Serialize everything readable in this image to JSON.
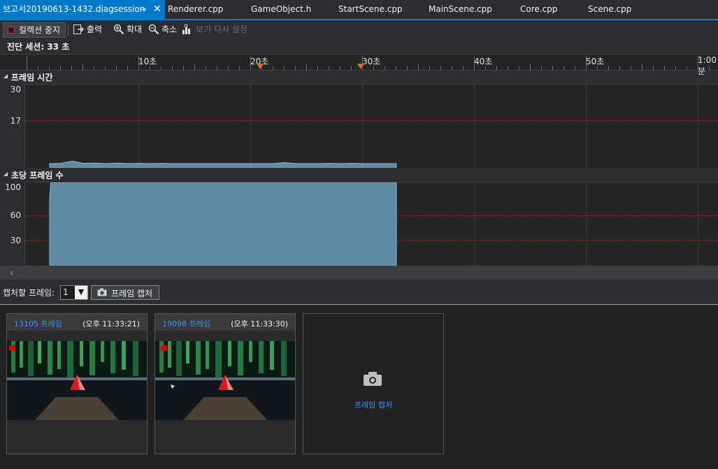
{
  "tabs": [
    {
      "label": "보고서20190613-1432.diagsession",
      "active": true
    },
    {
      "label": "Renderer.cpp"
    },
    {
      "label": "GameObject.h"
    },
    {
      "label": "StartScene.cpp"
    },
    {
      "label": "MainScene.cpp"
    },
    {
      "label": "Core.cpp"
    },
    {
      "label": "Scene.cpp"
    }
  ],
  "toolbar": {
    "stop_label": "컬렉션 중지",
    "output_label": "출력",
    "zoom_in_label": "확대",
    "zoom_out_label": "축소",
    "reset_view_label": "보기 다시 설정"
  },
  "session": {
    "label": "진단 세션: 33 초"
  },
  "ruler": {
    "labels": [
      "10초",
      "20초",
      "30초",
      "40초",
      "50초",
      "1:00분"
    ]
  },
  "sections": {
    "frame_time": {
      "title": "프레임 시간",
      "y_ticks": [
        "30",
        "17"
      ]
    },
    "fps": {
      "title": "초당 프레임 수",
      "y_ticks": [
        "100",
        "60",
        "30"
      ]
    }
  },
  "capture": {
    "label": "캡처할 프레임:",
    "count_value": "1",
    "button_label": "프레임 캡처",
    "frames": [
      {
        "name": "13105 프레임",
        "time": "(오후 11:33:21)"
      },
      {
        "name": "19098 프레임",
        "time": "(오후 11:33:30)"
      }
    ],
    "capture_card_label": "프레임 캡처"
  },
  "chart_data": [
    {
      "type": "area",
      "title": "프레임 시간",
      "x_unit": "초",
      "xlim": [
        0,
        63
      ],
      "ylim": [
        0,
        30
      ],
      "reference_lines": [
        17
      ],
      "series": [
        {
          "x": [
            2,
            3,
            4,
            5,
            6,
            7,
            8,
            9,
            10,
            11,
            12,
            13,
            14,
            15,
            16,
            17,
            18,
            19,
            20,
            21,
            22,
            23,
            24,
            25,
            26,
            27,
            28,
            29,
            30,
            31,
            32,
            33
          ],
          "values": [
            1.5,
            1.6,
            2.4,
            1.6,
            1.7,
            1.5,
            1.7,
            1.5,
            1.6,
            1.5,
            1.6,
            1.5,
            1.5,
            1.5,
            1.5,
            1.5,
            1.5,
            1.5,
            1.5,
            1.5,
            1.5,
            1.9,
            1.5,
            1.5,
            1.5,
            1.6,
            1.5,
            1.6,
            1.5,
            1.5,
            1.5,
            1.5
          ]
        }
      ]
    },
    {
      "type": "area",
      "title": "초당 프레임 수",
      "x_unit": "초",
      "xlim": [
        0,
        63
      ],
      "ylim": [
        0,
        100
      ],
      "reference_lines": [
        60,
        30
      ],
      "series": [
        {
          "x": [
            2,
            2.1,
            2.2,
            33
          ],
          "values": [
            80,
            100,
            110,
            110
          ]
        }
      ]
    }
  ]
}
